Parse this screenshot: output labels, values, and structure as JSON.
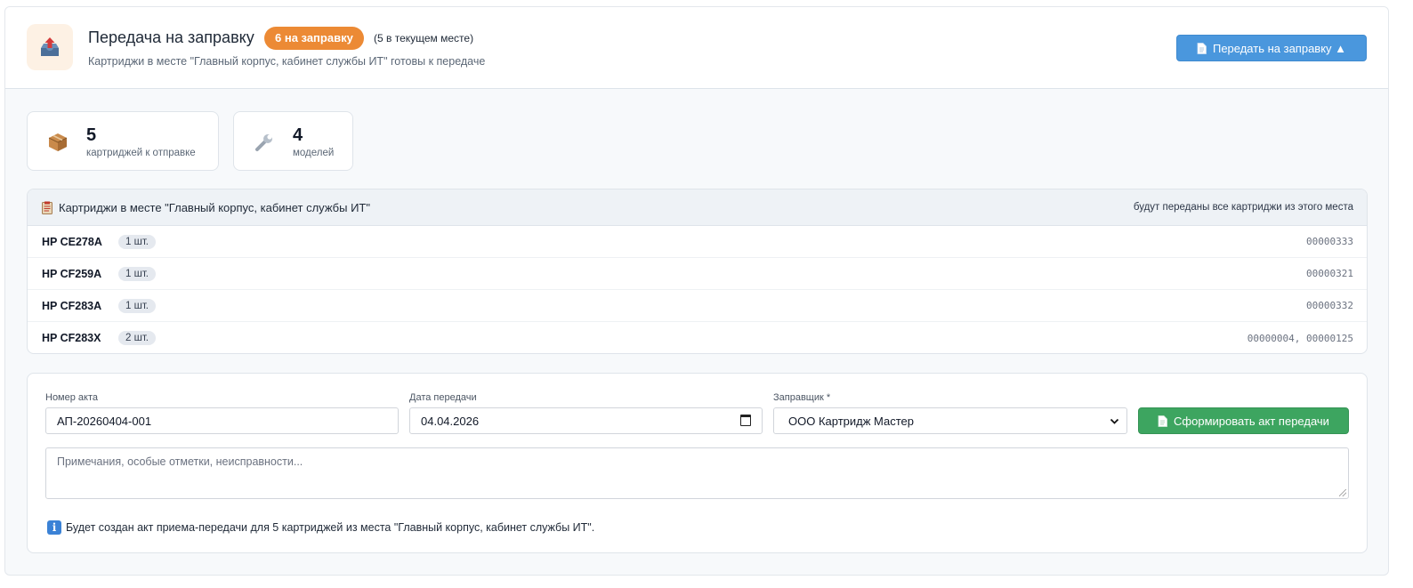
{
  "header": {
    "title": "Передача на заправку",
    "badge": "6 на заправку",
    "count_note": "(5 в текущем месте)",
    "subtitle": "Картриджи в месте \"Главный корпус, кабинет службы ИТ\" готовы к передаче",
    "transfer_button": "Передать на заправку ▲",
    "icon": "outbox-upload-icon"
  },
  "stats": [
    {
      "icon": "package-icon",
      "value": "5",
      "label": "картриджей к отправке"
    },
    {
      "icon": "wrench-icon",
      "value": "4",
      "label": "моделей"
    }
  ],
  "list": {
    "title": "Картриджи в месте \"Главный корпус, кабинет службы ИТ\"",
    "note": "будут переданы все картриджи из этого места",
    "rows": [
      {
        "model": "HP CE278A",
        "qty": "1 шт.",
        "serials": "00000333"
      },
      {
        "model": "HP CF259A",
        "qty": "1 шт.",
        "serials": "00000321"
      },
      {
        "model": "HP CF283A",
        "qty": "1 шт.",
        "serials": "00000332"
      },
      {
        "model": "HP CF283X",
        "qty": "2 шт.",
        "serials": "00000004, 00000125"
      }
    ]
  },
  "form": {
    "act_label": "Номер акта",
    "act_value": "АП-20260404-001",
    "date_label": "Дата передачи",
    "date_value": "04.04.2026",
    "refiller_label": "Заправщик *",
    "refiller_value": "ООО Картридж Мастер",
    "generate_button": "Сформировать акт передачи",
    "notes_placeholder": "Примечания, особые отметки, неисправности...",
    "info_text": "Будет создан акт приема-передачи для 5 картриджей из места \"Главный корпус, кабинет службы ИТ\"."
  },
  "colors": {
    "badge": "#ec8a35",
    "primary_button": "#4a97dd",
    "success_button": "#3da560"
  }
}
